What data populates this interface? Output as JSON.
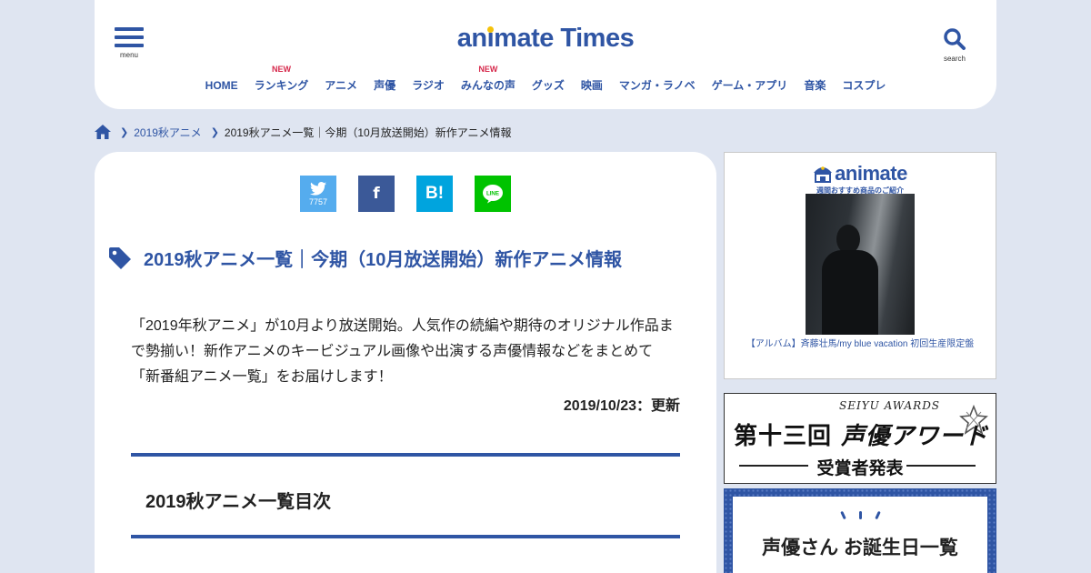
{
  "header": {
    "menu_label": "menu",
    "search_label": "search",
    "logo_pre": "an",
    "logo_i": "i",
    "logo_post": "mate Times",
    "nav": [
      {
        "label": "HOME",
        "badge": ""
      },
      {
        "label": "ランキング",
        "badge": "NEW"
      },
      {
        "label": "アニメ",
        "badge": ""
      },
      {
        "label": "声優",
        "badge": ""
      },
      {
        "label": "ラジオ",
        "badge": ""
      },
      {
        "label": "みんなの声",
        "badge": "NEW"
      },
      {
        "label": "グッズ",
        "badge": ""
      },
      {
        "label": "映画",
        "badge": ""
      },
      {
        "label": "マンガ・ラノベ",
        "badge": ""
      },
      {
        "label": "ゲーム・アプリ",
        "badge": ""
      },
      {
        "label": "音楽",
        "badge": ""
      },
      {
        "label": "コスプレ",
        "badge": ""
      }
    ]
  },
  "breadcrumb": {
    "category": "2019秋アニメ",
    "current": "2019秋アニメ一覧｜今期（10月放送開始）新作アニメ情報"
  },
  "share": {
    "twitter_count": "7757",
    "facebook_glyph": "f",
    "hatena_glyph": "B!"
  },
  "article": {
    "title": "2019秋アニメ一覧｜今期（10月放送開始）新作アニメ情報",
    "lead_lines": [
      "「2019年秋アニメ」が10月より放送開始。人気作の続編や期待のオリジナル作品ま",
      "で勢揃い！新作アニメのキービジュアル画像や出演する声優情報などをまとめて",
      "「新番組アニメ一覧」をお届けします！"
    ],
    "updated": "2019/10/23：更新",
    "toc_title": "2019秋アニメ一覧目次"
  },
  "sidebar": {
    "ad_brand": "animate",
    "ad_sub": "週間おすすめ商品のご紹介",
    "ad_caption": "【アルバム】斉藤壮馬/my blue vacation 初回生産限定盤",
    "awards_en": "SEIYU AWARDS",
    "awards_ja_num": "第十三回",
    "awards_ja_name": "声優アワード",
    "awards_result": "受賞者発表",
    "birthday_text": "声優さん お誕生日一覧"
  },
  "colors": {
    "brand_blue": "#2f55a4",
    "logo_yellow": "#f5c20a",
    "new_badge_red": "#d6284b",
    "page_bg": "#dfe5f1"
  }
}
